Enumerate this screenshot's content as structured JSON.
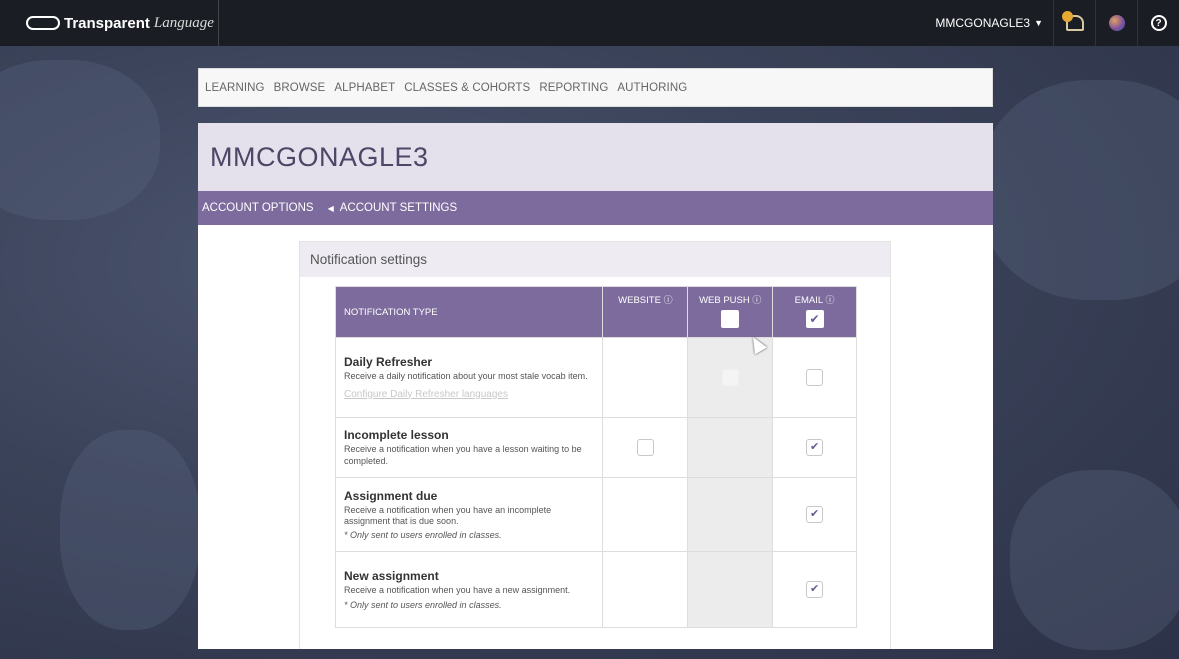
{
  "app": {
    "logo_bold": "Transparent",
    "logo_italic": "Language"
  },
  "topbar": {
    "username": "MMCGONAGLE3",
    "help_glyph": "?"
  },
  "nav": {
    "items": [
      "LEARNING",
      "BROWSE",
      "ALPHABET",
      "CLASSES & COHORTS",
      "REPORTING",
      "AUTHORING"
    ]
  },
  "page": {
    "title": "MMCGONAGLE3",
    "breadcrumb": [
      "ACCOUNT OPTIONS",
      "ACCOUNT SETTINGS"
    ]
  },
  "notifications": {
    "heading": "Notification settings",
    "columns": {
      "type": "NOTIFICATION TYPE",
      "website": "WEBSITE",
      "web_push": "WEB PUSH",
      "email": "EMAIL"
    },
    "info_glyph": "ⓘ",
    "header_email_checked": true,
    "header_push_checked": false,
    "rows": [
      {
        "title": "Daily Refresher",
        "text": "Receive a daily notification about your most stale vocab item.",
        "link": "Configure Daily Refresher languages",
        "website": null,
        "web_push": "disabled",
        "email": false
      },
      {
        "title": "Incomplete lesson",
        "text": "Receive a notification when you have a lesson waiting to be completed.",
        "website": false,
        "web_push": null,
        "email": true
      },
      {
        "title": "Assignment due",
        "text": "Receive a notification when you have an incomplete assignment that is due soon.",
        "note": "* Only sent to users enrolled in classes.",
        "website": null,
        "web_push": null,
        "email": true
      },
      {
        "title": "New assignment",
        "text": "Receive a notification when you have a new assignment.",
        "note": "* Only sent to users enrolled in classes.",
        "website": null,
        "web_push": null,
        "email": true
      }
    ],
    "check_glyph": "✔"
  }
}
